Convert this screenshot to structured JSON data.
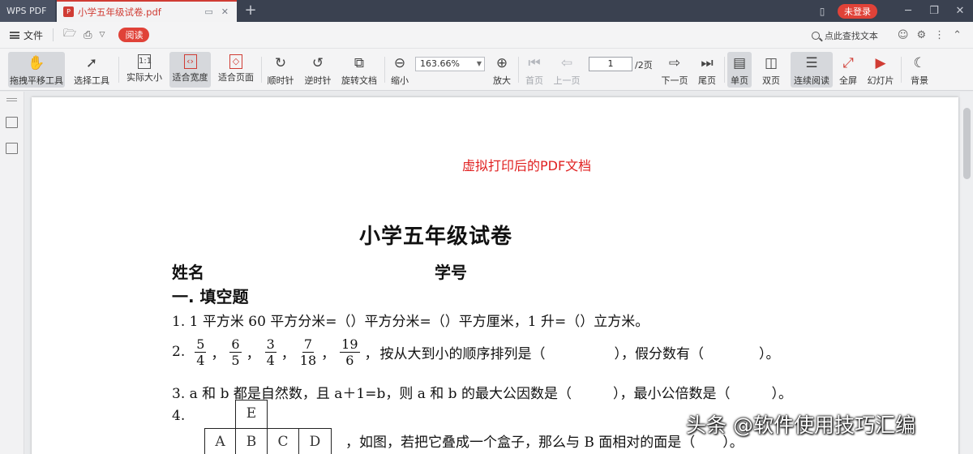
{
  "app": {
    "name": "WPS PDF",
    "tab_title": "小学五年级试卷.pdf",
    "login": "未登录"
  },
  "menu": {
    "file": "文件",
    "read_mode": "阅读",
    "search_hint": "点此查找文本"
  },
  "toolbar": {
    "pan_tool": "拖拽平移工具",
    "select_tool": "选择工具",
    "actual_size": "实际大小",
    "fit_width": "适合宽度",
    "fit_page": "适合页面",
    "rotate_cw": "顺时针",
    "rotate_ccw": "逆时针",
    "rotate_doc": "旋转文档",
    "zoom_out": "缩小",
    "zoom_value": "163.66%",
    "zoom_in": "放大",
    "first_page": "首页",
    "prev_page": "上一页",
    "current_page": "1",
    "total_pages": "/2页",
    "next_page": "下一页",
    "last_page": "尾页",
    "single_page": "单页",
    "double_page": "双页",
    "continuous": "连续阅读",
    "fullscreen": "全屏",
    "slideshow": "幻灯片",
    "background": "背景"
  },
  "document": {
    "note": "虚拟打印后的PDF文档",
    "title": "小学五年级试卷",
    "name_label": "姓名",
    "id_label": "学号",
    "section1": "一. 填空题",
    "q1": "1. 1 平方米 60 平方分米=（）平方分米=（）平方厘米，1 升=（）立方米。",
    "q2_prefix": "2.",
    "q2_fractions": [
      {
        "num": "5",
        "den": "4"
      },
      {
        "num": "6",
        "den": "5"
      },
      {
        "num": "3",
        "den": "4"
      },
      {
        "num": "7",
        "den": "18"
      },
      {
        "num": "19",
        "den": "6"
      }
    ],
    "q2_separator": "，",
    "q2_suffix": "按从大到小的顺序排列是（　　　　　），假分数有（　　　　）。",
    "q3": "3. a 和 b 都是自然数，且 a＋1=b，则 a 和 b 的最大公因数是（　　　），最小公倍数是（　　　）。",
    "q4_prefix": "4.",
    "q4_cells": {
      "top": "E",
      "row": [
        "A",
        "B",
        "C",
        "D"
      ]
    },
    "q4_text": "，如图，若把它叠成一个盒子，那么与 B 面相对的面是（　　）。"
  },
  "watermark": "头条 @软件使用技巧汇编"
}
